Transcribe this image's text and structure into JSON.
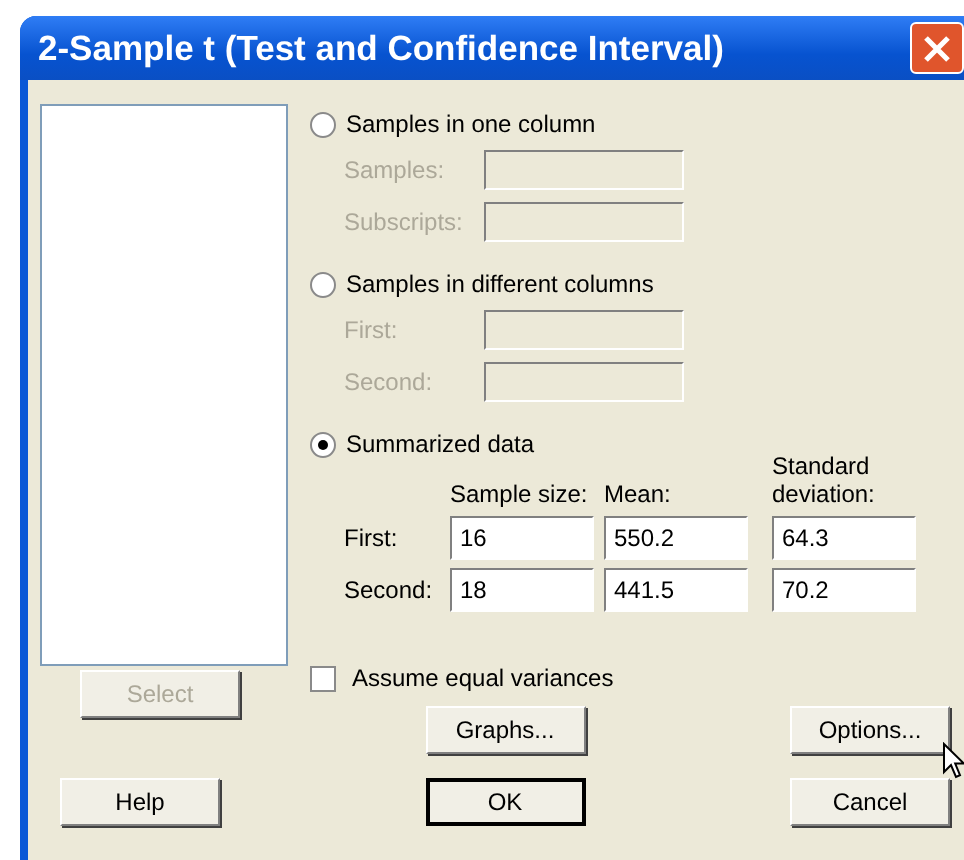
{
  "window": {
    "title": "2-Sample t (Test and Confidence Interval)"
  },
  "select_button": {
    "label": "Select",
    "disabled": true
  },
  "options": [
    {
      "kind": "fields",
      "label": "Samples in one column",
      "selected": false,
      "fields": [
        {
          "label": "Samples:",
          "disabled": true
        },
        {
          "label": "Subscripts:",
          "disabled": true
        }
      ]
    },
    {
      "kind": "fields",
      "label": "Samples in different columns",
      "selected": false,
      "fields": [
        {
          "label": "First:",
          "disabled": true
        },
        {
          "label": "Second:",
          "disabled": true
        }
      ]
    },
    {
      "kind": "table",
      "label": "Summarized data",
      "selected": true,
      "columns": [
        "Sample size:",
        "Mean:",
        "Standard deviation:"
      ],
      "rows": [
        {
          "label": "First:",
          "values": [
            "16",
            "550.2",
            "64.3"
          ]
        },
        {
          "label": "Second:",
          "values": [
            "18",
            "441.5",
            "70.2"
          ]
        }
      ]
    }
  ],
  "checkbox": {
    "label": "Assume equal variances",
    "checked": false
  },
  "buttons": [
    {
      "label": "Graphs...",
      "default": false
    },
    {
      "label": "Options...",
      "default": false
    },
    {
      "label": "Help",
      "default": false
    },
    {
      "label": "OK",
      "default": true
    },
    {
      "label": "Cancel",
      "default": false
    }
  ]
}
